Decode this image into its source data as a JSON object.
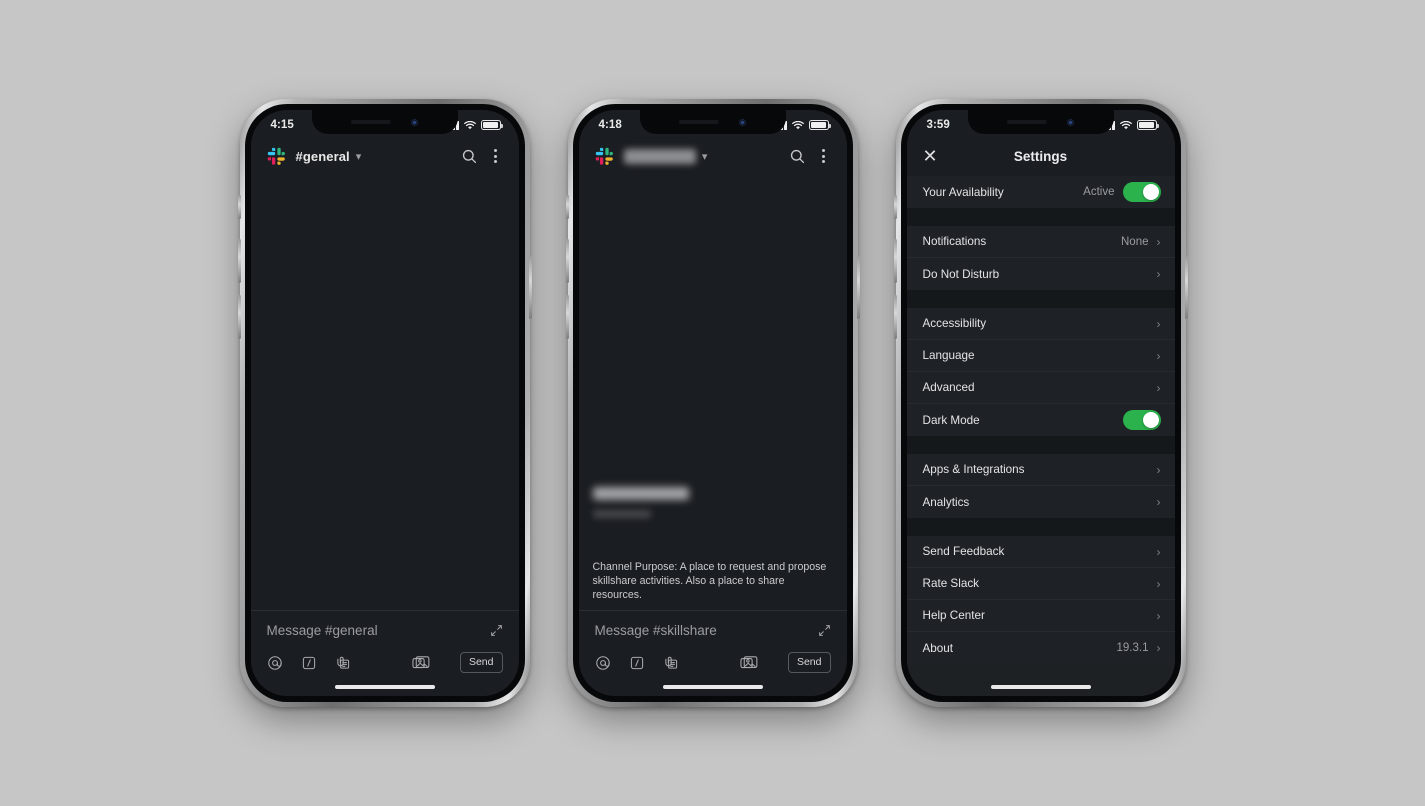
{
  "background_color": "#c6c6c6",
  "accent_green": "#2bb24c",
  "phones": [
    {
      "id": "phone-general",
      "type": "slack-channel",
      "status_bar": {
        "time": "4:15",
        "signal_icon": "cellular-bars-icon",
        "wifi_icon": "wifi-icon",
        "battery_icon": "battery-icon"
      },
      "header": {
        "logo_icon": "slack-logo-icon",
        "channel_name": "#general",
        "caret_icon": "chevron-down-icon",
        "search_icon": "search-icon",
        "more_icon": "kebab-menu-icon",
        "redacted": false
      },
      "messages": {
        "redacted_title": false,
        "purpose_text": ""
      },
      "composer": {
        "placeholder": "Message #general",
        "expand_icon": "expand-icon",
        "mention_icon": "at-mention-icon",
        "slash_icon": "slash-command-icon",
        "attach_icon": "attachment-icon",
        "photo_icon": "photo-library-icon",
        "send_label": "Send"
      }
    },
    {
      "id": "phone-skillshare",
      "type": "slack-channel",
      "status_bar": {
        "time": "4:18",
        "signal_icon": "cellular-bars-icon",
        "wifi_icon": "wifi-icon",
        "battery_icon": "battery-icon"
      },
      "header": {
        "logo_icon": "slack-logo-icon",
        "channel_name": "#skillshare",
        "caret_icon": "chevron-down-icon",
        "search_icon": "search-icon",
        "more_icon": "kebab-menu-icon",
        "redacted": true
      },
      "messages": {
        "redacted_title": true,
        "purpose_text": "Channel Purpose: A place to request and propose skillshare activities. Also a place to share resources."
      },
      "composer": {
        "placeholder": "Message #skillshare",
        "expand_icon": "expand-icon",
        "mention_icon": "at-mention-icon",
        "slash_icon": "slash-command-icon",
        "attach_icon": "attachment-icon",
        "photo_icon": "photo-library-icon",
        "send_label": "Send"
      }
    },
    {
      "id": "phone-settings",
      "type": "slack-settings",
      "status_bar": {
        "time": "3:59",
        "signal_icon": "cellular-bars-icon",
        "wifi_icon": "wifi-icon",
        "battery_icon": "battery-icon"
      },
      "header": {
        "close_icon": "close-icon",
        "title": "Settings"
      }
    }
  ],
  "settings": {
    "groups": [
      {
        "rows": [
          {
            "label": "Your Availability",
            "value": "Active",
            "control": "toggle",
            "toggle_on": true
          }
        ]
      },
      {
        "rows": [
          {
            "label": "Notifications",
            "value": "None",
            "control": "chevron"
          },
          {
            "label": "Do Not Disturb",
            "value": "",
            "control": "chevron"
          }
        ]
      },
      {
        "rows": [
          {
            "label": "Accessibility",
            "value": "",
            "control": "chevron"
          },
          {
            "label": "Language",
            "value": "",
            "control": "chevron"
          },
          {
            "label": "Advanced",
            "value": "",
            "control": "chevron"
          },
          {
            "label": "Dark Mode",
            "value": "",
            "control": "toggle",
            "toggle_on": true
          }
        ]
      },
      {
        "rows": [
          {
            "label": "Apps & Integrations",
            "value": "",
            "control": "chevron"
          },
          {
            "label": "Analytics",
            "value": "",
            "control": "chevron"
          }
        ]
      },
      {
        "rows": [
          {
            "label": "Send Feedback",
            "value": "",
            "control": "chevron"
          },
          {
            "label": "Rate Slack",
            "value": "",
            "control": "chevron"
          },
          {
            "label": "Help Center",
            "value": "",
            "control": "chevron"
          },
          {
            "label": "About",
            "value": "19.3.1",
            "control": "chevron"
          }
        ]
      }
    ],
    "chevron_glyph": "›"
  }
}
